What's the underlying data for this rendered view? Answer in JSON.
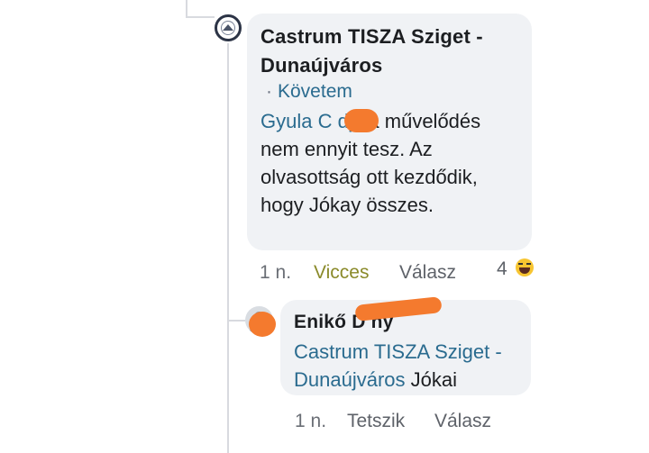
{
  "comment": {
    "author": "Castrum TISZA Sziget - Dunaújváros",
    "follow_label": "Követem",
    "mention": "Gyula C     dy",
    "text": ", a művelődés nem ennyit tesz. Az olvasottság ott kezdődik, hogy Jókay összes.",
    "timestamp": "1 n.",
    "reaction_label": "Vicces",
    "reply_label": "Válasz",
    "reaction_count": "4",
    "reaction_icon": "haha-emoji-icon"
  },
  "reply": {
    "author": "Enikő D      ny",
    "mention": "Castrum TISZA Sziget - Dunaújváros",
    "text": "Jókai",
    "timestamp": "1 n.",
    "like_label": "Tetszik",
    "reply_label": "Válasz"
  },
  "colors": {
    "link": "#2a6b8f",
    "bubble": "#f0f2f5",
    "reaction_label": "#8a8a2a",
    "redaction": "#f47a2e"
  }
}
